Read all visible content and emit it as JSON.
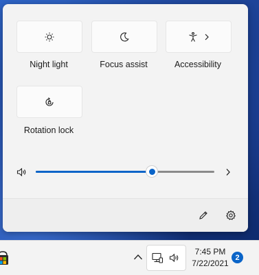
{
  "quick_settings": {
    "tiles": [
      {
        "label": "Night light",
        "icon": "brightness-sun-icon"
      },
      {
        "label": "Focus assist",
        "icon": "crescent-moon-icon"
      },
      {
        "label": "Accessibility",
        "icon": "accessibility-person-icon"
      },
      {
        "label": "Rotation lock",
        "icon": "rotation-lock-icon"
      }
    ],
    "volume": {
      "level": 0.65,
      "icon": "speaker-icon"
    },
    "footer_icons": [
      "pencil-edit-icon",
      "gear-settings-icon"
    ]
  },
  "taskbar": {
    "clock": {
      "time": "7:45 PM",
      "date": "7/22/2021"
    },
    "notifications_count": "2",
    "tray_icons": [
      "chevron-up-icon",
      "network-icon",
      "speaker-icon"
    ],
    "app_icon": "store-bag-icon"
  },
  "colors": {
    "accent": "#0a64c8",
    "panel_bg": "#f3f3f3",
    "tile_bg": "#fbfbfb"
  }
}
